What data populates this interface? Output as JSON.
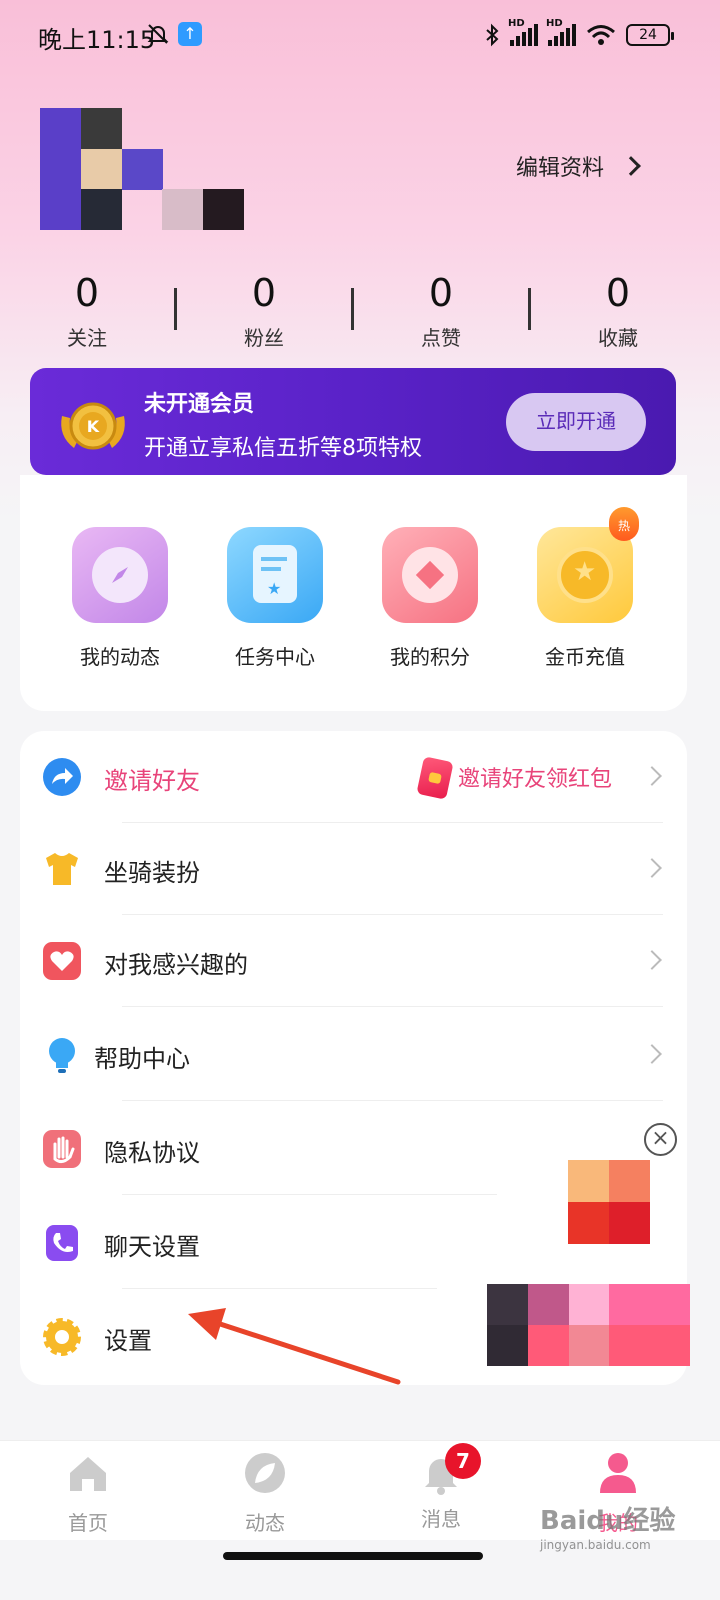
{
  "status_bar": {
    "time": "晚上11:15",
    "hd1": "HD",
    "hd2": "HD",
    "battery": "24"
  },
  "header": {
    "edit_profile_label": "编辑资料"
  },
  "stats": [
    {
      "value": "0",
      "label": "关注"
    },
    {
      "value": "0",
      "label": "粉丝"
    },
    {
      "value": "0",
      "label": "点赞"
    },
    {
      "value": "0",
      "label": "收藏"
    }
  ],
  "vip": {
    "title": "未开通会员",
    "subtitle": "开通立享私信五折等8项特权",
    "button": "立即开通"
  },
  "quick_actions": [
    {
      "label": "我的动态",
      "icon": "compass-icon"
    },
    {
      "label": "任务中心",
      "icon": "task-card-icon"
    },
    {
      "label": "我的积分",
      "icon": "points-icon"
    },
    {
      "label": "金币充值",
      "icon": "gold-coin-icon",
      "badge": "热"
    }
  ],
  "menu": {
    "items": [
      {
        "label": "邀请好友",
        "icon": "invite-arrow-icon",
        "hint": "邀请好友领红包"
      },
      {
        "label": "坐骑装扮",
        "icon": "tshirt-icon"
      },
      {
        "label": "对我感兴趣的",
        "icon": "heart-icon"
      },
      {
        "label": "帮助中心",
        "icon": "lightbulb-icon"
      },
      {
        "label": "隐私协议",
        "icon": "hand-icon"
      },
      {
        "label": "聊天设置",
        "icon": "phone-icon"
      },
      {
        "label": "设置",
        "icon": "gear-icon"
      }
    ]
  },
  "bottom_nav": {
    "items": [
      {
        "label": "首页",
        "icon": "home-icon"
      },
      {
        "label": "动态",
        "icon": "leaf-icon"
      },
      {
        "label": "消息",
        "icon": "bell-icon",
        "badge": "7"
      },
      {
        "label": "我的",
        "icon": "user-icon"
      }
    ]
  },
  "watermark": {
    "main": "Baidu经验",
    "sub": "jingyan.baidu.com"
  },
  "colors": {
    "accent_purple": "#5a22c8",
    "invite_pink": "#e8447a",
    "badge_red": "#e8142b"
  }
}
